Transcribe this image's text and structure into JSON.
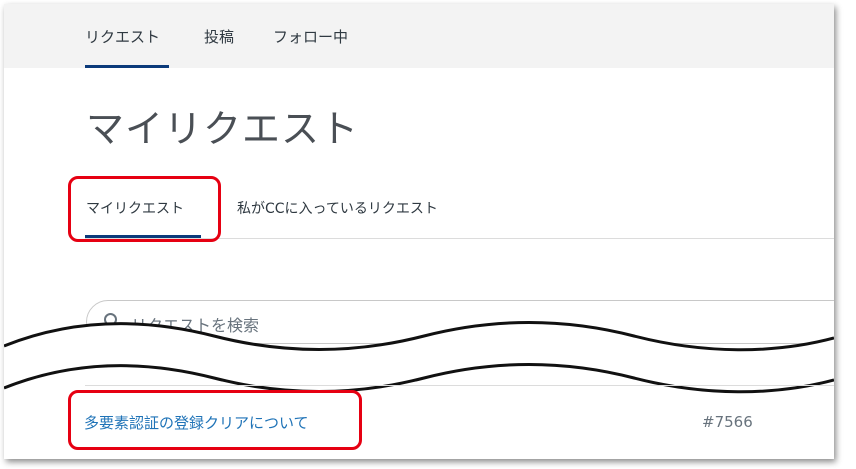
{
  "top_nav": {
    "items": [
      {
        "label": "リクエスト"
      },
      {
        "label": "投稿"
      },
      {
        "label": "フォロー中"
      }
    ]
  },
  "page": {
    "title": "マイリクエスト"
  },
  "sub_tabs": {
    "items": [
      {
        "label": "マイリクエスト"
      },
      {
        "label": "私がCCに入っているリクエスト"
      }
    ]
  },
  "search": {
    "placeholder": "リクエストを検索"
  },
  "requests": [
    {
      "title": "多要素認証の登録クリアについて",
      "id": "#7566"
    }
  ],
  "colors": {
    "accent": "#0b3a7a",
    "link": "#1f73b7",
    "highlight": "#e60012",
    "nav_bg": "#f3f3f3"
  }
}
